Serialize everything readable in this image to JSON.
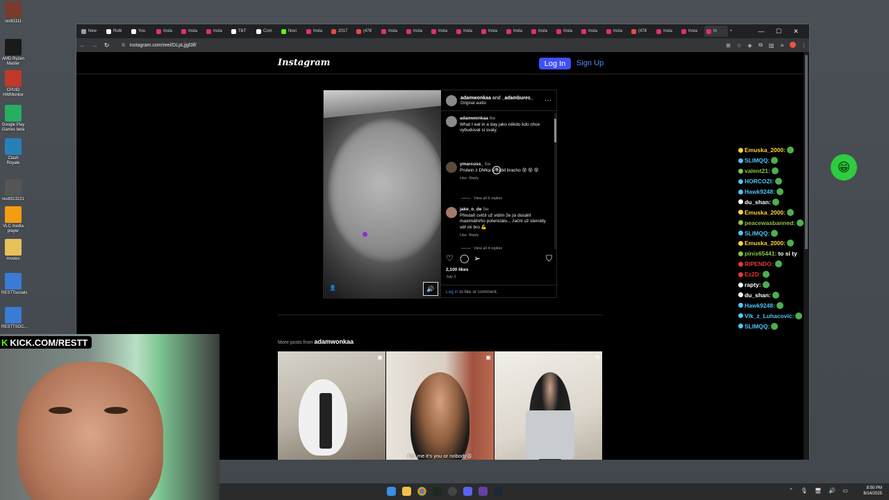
{
  "desktop": {
    "icons": [
      {
        "label": "restt1111",
        "color": "#7a3b2e"
      },
      {
        "label": "AMD Ryzen Master",
        "color": "#1a1a1a"
      },
      {
        "label": "CPUID HWMonitor",
        "color": "#c0392b"
      },
      {
        "label": "Google Play Games beta",
        "color": "#27ae60"
      },
      {
        "label": "Clash Royale",
        "color": "#2980b9"
      },
      {
        "label": "restt313131",
        "color": "#555555"
      },
      {
        "label": "VLC media player",
        "color": "#f39c12"
      },
      {
        "label": "movies",
        "color": "#e8c15a"
      },
      {
        "label": "RESTTsocials",
        "color": "#3a7bd5"
      },
      {
        "label": "RESTTSOC...",
        "color": "#3a7bd5"
      }
    ]
  },
  "browser": {
    "tabs": [
      {
        "label": "New",
        "color": "#9aa0a6"
      },
      {
        "label": "Robl",
        "color": "#ffffff"
      },
      {
        "label": "You",
        "color": "#ffffff"
      },
      {
        "label": "Insta",
        "color": "#e1306c"
      },
      {
        "label": "Insta",
        "color": "#e1306c"
      },
      {
        "label": "Insta",
        "color": "#e1306c"
      },
      {
        "label": "TikT",
        "color": "#ffffff"
      },
      {
        "label": "Com",
        "color": "#ffffff"
      },
      {
        "label": "Novi",
        "color": "#53fc18"
      },
      {
        "label": "Insta",
        "color": "#e1306c"
      },
      {
        "label": "2017",
        "color": "#e74c3c"
      },
      {
        "label": "(478",
        "color": "#e74c3c"
      },
      {
        "label": "Insta",
        "color": "#e1306c"
      },
      {
        "label": "Insta",
        "color": "#e1306c"
      },
      {
        "label": "Insta",
        "color": "#e1306c"
      },
      {
        "label": "Insta",
        "color": "#e1306c"
      },
      {
        "label": "Insta",
        "color": "#e1306c"
      },
      {
        "label": "Insta",
        "color": "#e1306c"
      },
      {
        "label": "Insta",
        "color": "#e1306c"
      },
      {
        "label": "Insta",
        "color": "#e1306c"
      },
      {
        "label": "Insta",
        "color": "#e1306c"
      },
      {
        "label": "Insta",
        "color": "#e1306c"
      },
      {
        "label": "(478",
        "color": "#e74c3c"
      },
      {
        "label": "Insta",
        "color": "#e1306c"
      },
      {
        "label": "Insta",
        "color": "#e1306c"
      },
      {
        "label": "In",
        "color": "#e1306c",
        "active": true
      }
    ],
    "url": "instagram.com/reel/DLpLjjgl0lf/"
  },
  "instagram": {
    "logo": "Instagram",
    "login_label": "Log In",
    "signup_label": "Sign Up",
    "post": {
      "author": "adamwonkaa",
      "and_text": "and",
      "coauthor": "_adambures_",
      "audio": "Original audio",
      "caption_user": "adamwonkaa",
      "caption_time": "6w",
      "caption_text": "What I eat in a day jako někdo kdo chce vybudovat si svaly.",
      "comments": [
        {
          "user": "ymarcuss_",
          "time": "5w",
          "text": "Protein z DMka si zabil bracho 😵 😵 😵",
          "like": "Like",
          "reply": "Reply",
          "replies": "View all 6 replies"
        },
        {
          "user": "jake_o_de",
          "time": "5w",
          "text": "Přestaň cvičit už vidím že jsi dosáhl maximálního potenciálu... začni už steroidy věř mi bro 💪",
          "like": "Like",
          "reply": "Reply",
          "replies": "View all 4 replies"
        }
      ],
      "likes": "2,100 likes",
      "date": "July 3",
      "login_link": "Log in",
      "login_rest": "to like or comment."
    },
    "more_posts_prefix": "More posts from",
    "more_posts_user": "adamwonkaa",
    "thumbnail_caption": "For me it's you or nobody😩"
  },
  "chat": [
    {
      "user": "Emuska_2000:",
      "color": "#ffd23f",
      "msg": "",
      "emote": true
    },
    {
      "user": "SLIMQQ:",
      "color": "#4fc3f7",
      "msg": "",
      "emote": true
    },
    {
      "user": "valent21:",
      "color": "#8bc34a",
      "msg": "",
      "emote": true
    },
    {
      "user": "HORCOZI:",
      "color": "#4fc3f7",
      "msg": "",
      "emote": true
    },
    {
      "user": "Hawk9248:",
      "color": "#4fc3f7",
      "msg": "",
      "emote": true
    },
    {
      "user": "du_shan:",
      "color": "#ffffff",
      "msg": "",
      "emote": true
    },
    {
      "user": "Emuska_2000:",
      "color": "#ffd23f",
      "msg": "",
      "emote": true
    },
    {
      "user": "peacewasbanned:",
      "color": "#8bc34a",
      "msg": "",
      "emote": true
    },
    {
      "user": "SLIMQQ:",
      "color": "#4fc3f7",
      "msg": "",
      "emote": true
    },
    {
      "user": "Emuska_2000:",
      "color": "#ffd23f",
      "msg": "",
      "emote": true
    },
    {
      "user": "pinis65441:",
      "color": "#8bc34a",
      "msg": "to si ty",
      "emote": false
    },
    {
      "user": "RIPENDO:",
      "color": "#e53935",
      "msg": "",
      "emote": true
    },
    {
      "user": "Ez2D:",
      "color": "#e53935",
      "msg": "",
      "emote": true
    },
    {
      "user": "rapty:",
      "color": "#ffffff",
      "msg": "",
      "emote": true
    },
    {
      "user": "du_shan:",
      "color": "#ffffff",
      "msg": "",
      "emote": true
    },
    {
      "user": "Hawk9248:",
      "color": "#4fc3f7",
      "msg": "",
      "emote": true
    },
    {
      "user": "Vlk_z_Luhacovic:",
      "color": "#4fc3f7",
      "msg": "",
      "emote": true
    },
    {
      "user": "SLIMQQ:",
      "color": "#4fc3f7",
      "msg": "",
      "emote": true
    }
  ],
  "stream": {
    "kick_tag_brand": "K",
    "kick_tag_text": "KICK.COM/RESTT"
  },
  "taskbar": {
    "time": "8:50 PM",
    "date": "8/14/2025"
  }
}
